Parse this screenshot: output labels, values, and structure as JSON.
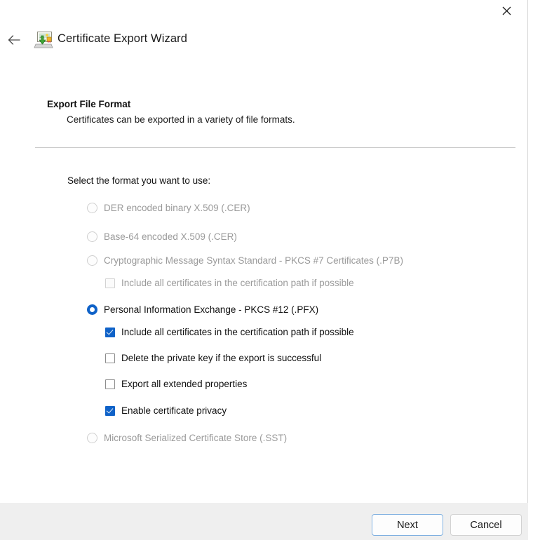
{
  "window": {
    "title": "Certificate Export Wizard",
    "close_label": "✕",
    "back_label": "←",
    "icon": "certificate-export-icon"
  },
  "page": {
    "heading": "Export File Format",
    "subheading": "Certificates can be exported in a variety of file formats.",
    "prompt": "Select the format you want to use:"
  },
  "options": [
    {
      "id": "der",
      "type": "radio",
      "label": "DER encoded binary X.509 (.CER)",
      "checked": false,
      "enabled": false,
      "indent": 0
    },
    {
      "id": "base64",
      "type": "radio",
      "label": "Base-64 encoded X.509 (.CER)",
      "checked": false,
      "enabled": false,
      "indent": 0
    },
    {
      "id": "pkcs7",
      "type": "radio",
      "label": "Cryptographic Message Syntax Standard - PKCS #7 Certificates (.P7B)",
      "checked": false,
      "enabled": false,
      "indent": 0
    },
    {
      "id": "pkcs7-include-all",
      "type": "checkbox",
      "label": "Include all certificates in the certification path if possible",
      "checked": false,
      "enabled": false,
      "indent": 1
    },
    {
      "id": "pfx",
      "type": "radio",
      "label": "Personal Information Exchange - PKCS #12 (.PFX)",
      "checked": true,
      "enabled": true,
      "indent": 0
    },
    {
      "id": "pfx-include-all",
      "type": "checkbox",
      "label": "Include all certificates in the certification path if possible",
      "checked": true,
      "enabled": true,
      "indent": 1
    },
    {
      "id": "delete-private-key",
      "type": "checkbox",
      "label": "Delete the private key if the export is successful",
      "checked": false,
      "enabled": true,
      "indent": 1
    },
    {
      "id": "export-extended-properties",
      "type": "checkbox",
      "label": "Export all extended properties",
      "checked": false,
      "enabled": true,
      "indent": 1
    },
    {
      "id": "enable-certificate-privacy",
      "type": "checkbox",
      "label": "Enable certificate privacy",
      "checked": true,
      "enabled": true,
      "indent": 1
    },
    {
      "id": "sst",
      "type": "radio",
      "label": "Microsoft Serialized Certificate Store (.SST)",
      "checked": false,
      "enabled": false,
      "indent": 0
    }
  ],
  "footer": {
    "next_label": "Next",
    "cancel_label": "Cancel"
  },
  "colors": {
    "accent": "#0f62c8",
    "focus_border": "#7fb0e0",
    "footer_bg": "#efefef",
    "rule": "#c8c8c8",
    "disabled_text": "#9a9a9a"
  }
}
